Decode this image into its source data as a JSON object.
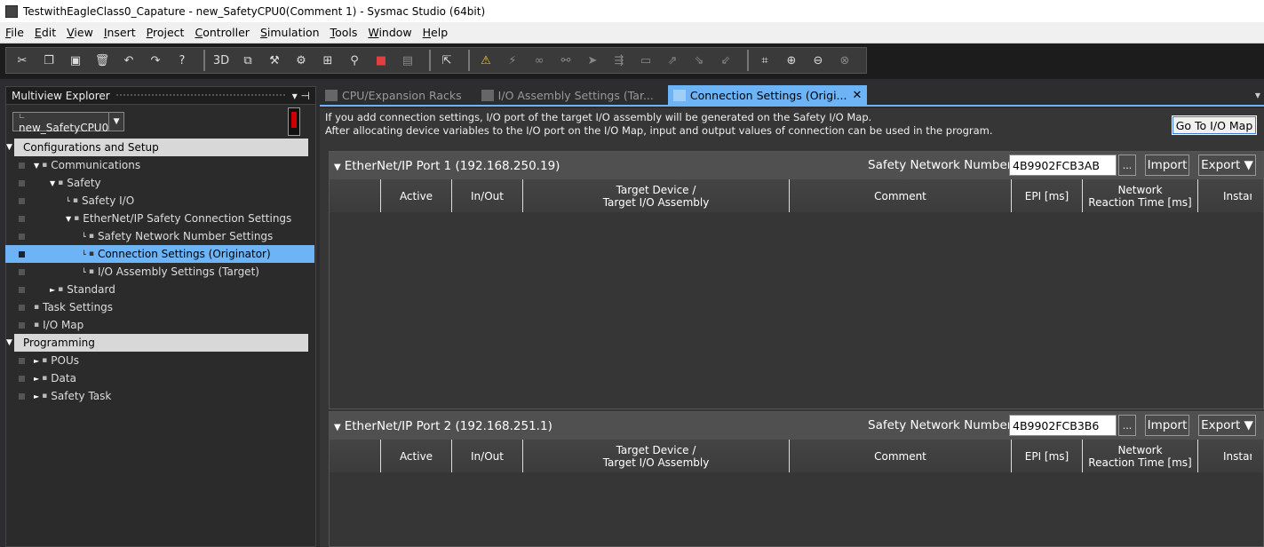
{
  "window": {
    "title": "TestwithEagleClass0_Capature - new_SafetyCPU0(Comment 1) - Sysmac Studio (64bit)"
  },
  "menu": [
    {
      "u": "F",
      "rest": "ile"
    },
    {
      "u": "E",
      "rest": "dit"
    },
    {
      "u": "V",
      "rest": "iew"
    },
    {
      "u": "I",
      "rest": "nsert"
    },
    {
      "u": "P",
      "rest": "roject"
    },
    {
      "u": "C",
      "rest": "ontroller"
    },
    {
      "u": "S",
      "rest": "imulation"
    },
    {
      "u": "T",
      "rest": "ools"
    },
    {
      "u": "W",
      "rest": "indow"
    },
    {
      "u": "H",
      "rest": "elp"
    }
  ],
  "explorer": {
    "title": "Multiview Explorer",
    "pin": "▾ ⊣",
    "device": "new_SafetyCPU0",
    "tree": [
      {
        "label": "Configurations and Setup",
        "section": true
      },
      {
        "label": "Communications",
        "level": 1,
        "tri": "▼"
      },
      {
        "label": "Safety",
        "level": 2,
        "tri": "▼"
      },
      {
        "label": "Safety I/O",
        "level": 3,
        "tri": "└"
      },
      {
        "label": "EtherNet/IP Safety Connection Settings",
        "level": 3,
        "tri": "▼"
      },
      {
        "label": "Safety Network Number Settings",
        "level": 4,
        "tri": "└"
      },
      {
        "label": "Connection Settings (Originator)",
        "level": 4,
        "tri": "└",
        "selected": true
      },
      {
        "label": "I/O Assembly Settings (Target)",
        "level": 4,
        "tri": "└"
      },
      {
        "label": "Standard",
        "level": 2,
        "tri": "►"
      },
      {
        "label": "Task Settings",
        "level": 1,
        "tri": ""
      },
      {
        "label": "I/O Map",
        "level": 1,
        "tri": ""
      },
      {
        "label": "Programming",
        "section": true
      },
      {
        "label": "POUs",
        "level": 1,
        "tri": "►"
      },
      {
        "label": "Data",
        "level": 1,
        "tri": "►"
      },
      {
        "label": "Safety Task",
        "level": 1,
        "tri": "►"
      }
    ]
  },
  "tabs": [
    {
      "label": "CPU/Expansion Racks",
      "active": false
    },
    {
      "label": "I/O Assembly Settings (Tar...",
      "active": false
    },
    {
      "label": "Connection Settings (Origi...",
      "active": true
    }
  ],
  "info": {
    "line1": "If you add connection settings, I/O port of the target I/O assembly will be generated on the Safety I/O Map.",
    "line2": "After allocating device variables to the I/O port on the I/O Map, input and output values of connection can be used in the program."
  },
  "goto_label": "Go To I/O Map",
  "ports": [
    {
      "title": "EtherNet/IP Port 1 (192.168.250.19)",
      "snn_label": "Safety Network Number :",
      "snn": "4B9902FCB3AB",
      "dots": "...",
      "import": "Import",
      "export": "Export ▼"
    },
    {
      "title": "EtherNet/IP Port 2 (192.168.251.1)",
      "snn_label": "Safety Network Number :",
      "snn": "4B9902FCB3B6",
      "dots": "...",
      "import": "Import",
      "export": "Export ▼"
    }
  ],
  "columns": [
    "",
    "Active",
    "In/Out",
    "Target Device /\nTarget I/O Assembly",
    "Comment",
    "EPI [ms]",
    "Network\nReaction Time [ms]",
    "Instar"
  ]
}
